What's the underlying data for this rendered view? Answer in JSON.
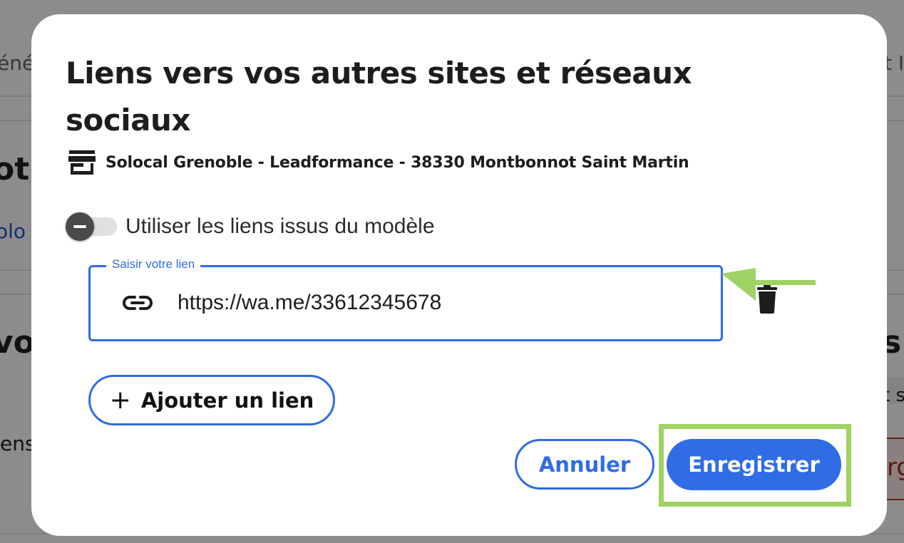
{
  "background": {
    "tab_left": "éné",
    "tab_right": "t I",
    "heading1": "otr",
    "link_fragment": "olo",
    "heading2": "vo",
    "heading_right": "s",
    "text_fragment": "ens",
    "text_right": "t s",
    "button_fragment": "rg"
  },
  "modal": {
    "title": "Liens vers vos autres sites et réseaux sociaux",
    "store_label": "Solocal Grenoble - Leadformance - 38330 Montbonnot Saint Martin",
    "store_icon": "store-icon",
    "toggle_label": "Utiliser les liens issus du modèle",
    "toggle_state": "indeterminate",
    "link_field": {
      "legend": "Saisir votre lien",
      "value": "https://wa.me/33612345678",
      "icon": "link-icon"
    },
    "delete_icon": "trash-icon",
    "add_link_label": "Ajouter un lien",
    "cancel_label": "Annuler",
    "save_label": "Enregistrer"
  },
  "colors": {
    "primary": "#2f6ce5",
    "annotation_green": "#9fd264",
    "title_text": "#1d1d1f"
  }
}
